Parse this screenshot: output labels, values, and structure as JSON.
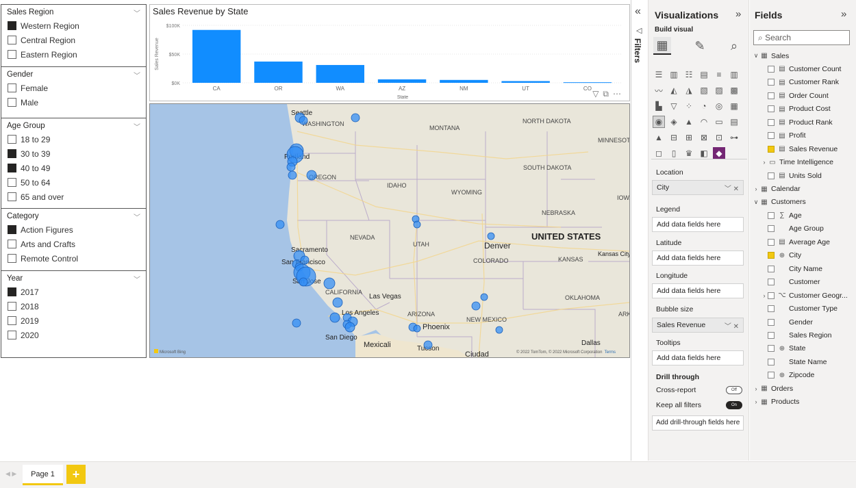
{
  "slicers": [
    {
      "title": "Sales Region",
      "items": [
        {
          "label": "Western Region",
          "checked": true
        },
        {
          "label": "Central Region",
          "checked": false
        },
        {
          "label": "Eastern Region",
          "checked": false
        }
      ]
    },
    {
      "title": "Gender",
      "items": [
        {
          "label": "Female",
          "checked": false
        },
        {
          "label": "Male",
          "checked": false
        }
      ]
    },
    {
      "title": "Age Group",
      "items": [
        {
          "label": "18 to 29",
          "checked": false
        },
        {
          "label": "30 to 39",
          "checked": true
        },
        {
          "label": "40 to 49",
          "checked": true
        },
        {
          "label": "50 to 64",
          "checked": false
        },
        {
          "label": "65 and over",
          "checked": false
        }
      ]
    },
    {
      "title": "Category",
      "items": [
        {
          "label": "Action Figures",
          "checked": true
        },
        {
          "label": "Arts and Crafts",
          "checked": false
        },
        {
          "label": "Remote Control",
          "checked": false
        }
      ]
    },
    {
      "title": "Year",
      "items": [
        {
          "label": "2017",
          "checked": true
        },
        {
          "label": "2018",
          "checked": false
        },
        {
          "label": "2019",
          "checked": false
        },
        {
          "label": "2020",
          "checked": false
        }
      ]
    }
  ],
  "chart_data": {
    "type": "bar",
    "title": "Sales Revenue by State",
    "xlabel": "State",
    "ylabel": "Sales Revenue",
    "categories": [
      "CA",
      "OR",
      "WA",
      "AZ",
      "NM",
      "UT",
      "CO"
    ],
    "values": [
      92000,
      37000,
      31000,
      6000,
      5000,
      3000,
      1000
    ],
    "yticks": [
      "$0K",
      "$50K",
      "$100K"
    ],
    "ylim": [
      0,
      100000
    ],
    "bar_color": "#118dff"
  },
  "map": {
    "states": [
      "WASHINGTON",
      "MONTANA",
      "NORTH DAKOTA",
      "MINNESOTA",
      "SOUTH DAKOTA",
      "OREGON",
      "IDAHO",
      "WYOMING",
      "IOWA",
      "NEBRASKA",
      "NEVADA",
      "UTAH",
      "COLORADO",
      "KANSAS",
      "CALIFORNIA",
      "ARIZONA",
      "NEW MEXICO",
      "OKLAHOMA",
      "ARK"
    ],
    "country": "UNITED STATES",
    "cities": [
      "Seattle",
      "Portland",
      "Sacramento",
      "San Francisco",
      "San Jose",
      "Las Vegas",
      "Denver",
      "Kansas City",
      "Los Angeles",
      "San Diego",
      "Phoenix",
      "Tucson",
      "Dallas",
      "Mexicali",
      "Ciudad"
    ],
    "attribution": "© 2022 TomTom, © 2022 Microsoft Corporation",
    "terms": "Terms",
    "logo": "Microsoft Bing",
    "bubble_color": "#2f8cf5"
  },
  "page_tabs": {
    "current": "Page 1",
    "add": "+"
  },
  "filters_pane": {
    "label": "Filters",
    "collapse": "«"
  },
  "visualizations": {
    "title": "Visualizations",
    "collapse": "»",
    "build_visual": "Build visual",
    "wells": [
      {
        "label": "Location",
        "value": "City",
        "filled": true
      },
      {
        "label": "Legend",
        "value": "Add data fields here",
        "filled": false
      },
      {
        "label": "Latitude",
        "value": "Add data fields here",
        "filled": false
      },
      {
        "label": "Longitude",
        "value": "Add data fields here",
        "filled": false
      },
      {
        "label": "Bubble size",
        "value": "Sales Revenue",
        "filled": true
      },
      {
        "label": "Tooltips",
        "value": "Add data fields here",
        "filled": false
      }
    ],
    "drill_through": "Drill through",
    "cross_report": "Cross-report",
    "cross_report_state": "Off",
    "keep_all_filters": "Keep all filters",
    "keep_all_filters_state": "On",
    "add_drill": "Add drill-through fields here"
  },
  "fields": {
    "title": "Fields",
    "collapse": "»",
    "search_placeholder": "Search",
    "rows": [
      {
        "label": "Sales",
        "kind": "table",
        "expanded": true,
        "indent": 0
      },
      {
        "label": "Customer Count",
        "kind": "measure",
        "indent": 1,
        "checked": false
      },
      {
        "label": "Customer Rank",
        "kind": "measure",
        "indent": 1,
        "checked": false
      },
      {
        "label": "Order Count",
        "kind": "measure",
        "indent": 1,
        "checked": false
      },
      {
        "label": "Product Cost",
        "kind": "measure",
        "indent": 1,
        "checked": false
      },
      {
        "label": "Product Rank",
        "kind": "measure",
        "indent": 1,
        "checked": false
      },
      {
        "label": "Profit",
        "kind": "measure",
        "indent": 1,
        "checked": false
      },
      {
        "label": "Sales Revenue",
        "kind": "measure",
        "indent": 1,
        "checked": true
      },
      {
        "label": "Time Intelligence",
        "kind": "folder",
        "indent": 1,
        "collapsed": true
      },
      {
        "label": "Units Sold",
        "kind": "measure",
        "indent": 1,
        "checked": false
      },
      {
        "label": "Calendar",
        "kind": "table",
        "collapsed": true,
        "indent": 0
      },
      {
        "label": "Customers",
        "kind": "table",
        "expanded": true,
        "indent": 0
      },
      {
        "label": "Age",
        "kind": "sum",
        "indent": 1,
        "checked": false
      },
      {
        "label": "Age Group",
        "kind": "column",
        "indent": 1,
        "checked": false
      },
      {
        "label": "Average Age",
        "kind": "measure",
        "indent": 1,
        "checked": false
      },
      {
        "label": "City",
        "kind": "geo",
        "indent": 1,
        "checked": true
      },
      {
        "label": "City Name",
        "kind": "column",
        "indent": 1,
        "checked": false
      },
      {
        "label": "Customer",
        "kind": "column",
        "indent": 1,
        "checked": false
      },
      {
        "label": "Customer Geogr...",
        "kind": "hierarchy",
        "indent": 1,
        "checked": false,
        "collapsed": true
      },
      {
        "label": "Customer Type",
        "kind": "column",
        "indent": 1,
        "checked": false
      },
      {
        "label": "Gender",
        "kind": "column",
        "indent": 1,
        "checked": false
      },
      {
        "label": "Sales Region",
        "kind": "column",
        "indent": 1,
        "checked": false
      },
      {
        "label": "State",
        "kind": "geo",
        "indent": 1,
        "checked": false
      },
      {
        "label": "State Name",
        "kind": "column",
        "indent": 1,
        "checked": false
      },
      {
        "label": "Zipcode",
        "kind": "geo",
        "indent": 1,
        "checked": false
      },
      {
        "label": "Orders",
        "kind": "table",
        "collapsed": true,
        "indent": 0
      },
      {
        "label": "Products",
        "kind": "table",
        "collapsed": true,
        "indent": 0
      }
    ]
  }
}
